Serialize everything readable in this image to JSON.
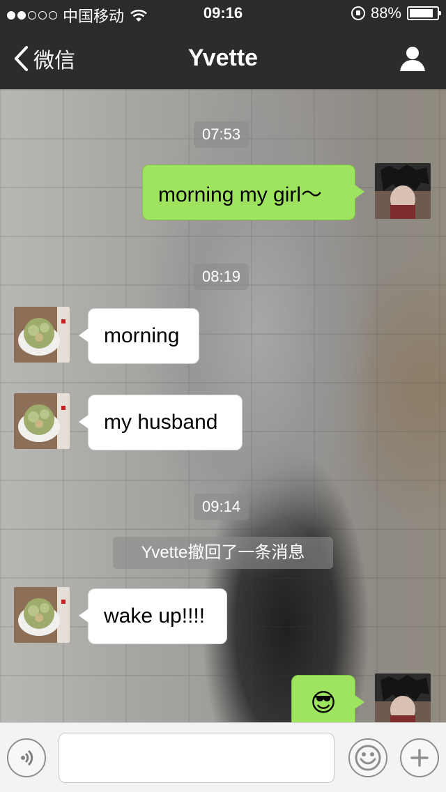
{
  "status_bar": {
    "carrier": "中国移动",
    "time": "09:16",
    "battery": "88%",
    "battery_level": 0.88
  },
  "nav": {
    "back_label": "微信",
    "title": "Yvette"
  },
  "chat": {
    "timestamps": [
      "07:53",
      "08:19",
      "09:14"
    ],
    "messages": [
      {
        "side": "right",
        "text": "morning my girl～"
      },
      {
        "side": "left",
        "text": "morning"
      },
      {
        "side": "left",
        "text": "my husband"
      },
      {
        "side": "left",
        "text": "wake up!!!!"
      },
      {
        "side": "right",
        "text": "😎",
        "emoji_name": "cool-sunglasses-emoji"
      }
    ],
    "system_notice": "Yvette撤回了一条消息"
  },
  "toolbar": {
    "input_value": ""
  },
  "colors": {
    "bar_bg": "#2c2c2c",
    "sent_bubble": "#9fe45f",
    "recv_bubble": "#ffffff"
  },
  "icons": [
    "back-chevron-icon",
    "profile-icon",
    "wifi-icon",
    "lock-rotation-icon",
    "battery-icon",
    "voice-icon",
    "emoji-icon",
    "plus-icon"
  ]
}
